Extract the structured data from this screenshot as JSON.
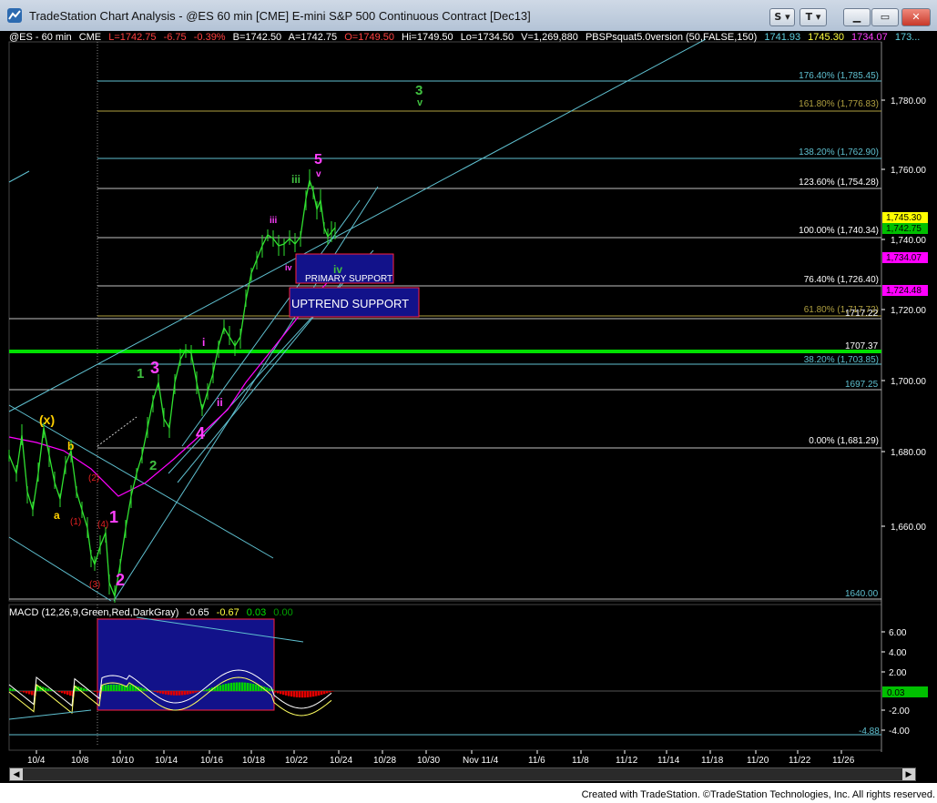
{
  "window": {
    "title": "TradeStation Chart Analysis - @ES 60 min [CME] E-mini S&P 500 Continuous Contract [Dec13]",
    "s_button": "S",
    "t_button": "T"
  },
  "header": {
    "symbol": "@ES - 60 min",
    "exchange": "CME",
    "last": "L=1742.75",
    "change": "-6.75",
    "pct_change": "-0.39%",
    "bid": "B=1742.50",
    "ask": "A=1742.75",
    "open": "O=1749.50",
    "high": "Hi=1749.50",
    "low": "Lo=1734.50",
    "volume": "V=1,269,880",
    "indicator": "PBSPsquat5.0version (50,FALSE,150)",
    "ind_v1": "1741.93",
    "ind_v2": "1745.30",
    "ind_v3": "1734.07",
    "ind_v4": "173..."
  },
  "price_axis": {
    "ticks": [
      "1,780.00",
      "1,760.00",
      "1,740.00",
      "1,720.00",
      "1,700.00",
      "1,680.00",
      "1,660.00"
    ],
    "tags": [
      {
        "text": "1,745.30",
        "bg": "#ffff00",
        "fg": "#000000"
      },
      {
        "text": "1,742.75",
        "bg": "#00c000",
        "fg": "#000000"
      },
      {
        "text": "1,734.07",
        "bg": "#ff00ff",
        "fg": "#000000"
      },
      {
        "text": "1,724.48",
        "bg": "#ff00ff",
        "fg": "#000000"
      }
    ]
  },
  "fib_labels": [
    {
      "text": "176.40% (1,785.45)",
      "color": "#5fc0d0"
    },
    {
      "text": "161.80% (1,776.83)",
      "color": "#b0a040"
    },
    {
      "text": "138.20% (1,762.90)",
      "color": "#5fc0d0"
    },
    {
      "text": "123.60% (1,754.28)",
      "color": "#ffffff"
    },
    {
      "text": "100.00% (1,740.34)",
      "color": "#ffffff"
    },
    {
      "text": "76.40% (1,726.40)",
      "color": "#ffffff"
    },
    {
      "text": "61.80% (1,717.72)",
      "color": "#b0a040"
    },
    {
      "text": "38.20% (1,703.85)",
      "color": "#5fc0d0"
    },
    {
      "text": "0.00% (1,681.29)",
      "color": "#ffffff"
    }
  ],
  "level_labels": {
    "l1717": "1717.22",
    "l1707": "1707.37",
    "l1697": "1697.25",
    "l1640": "1640.00"
  },
  "wave_labels": {
    "w3_big": "3",
    "v_big": "v",
    "w5": "5",
    "v_small": "v",
    "iii_green": "iii",
    "iii_pink": "iii",
    "iv_pink": "iv",
    "iv_green": "iv",
    "i_pink": "i",
    "ii_pink": "ii",
    "w1_green": "1",
    "w3_pink": "3",
    "w2_green": "2",
    "w4_pink": "4",
    "x": "(x)",
    "b": "b",
    "a": "a",
    "p2": "(2)",
    "p1": "(1)",
    "p4": "(4)",
    "p3": "(3)",
    "w1_pink": "1",
    "w2_pink": "2"
  },
  "boxes": {
    "primary": "PRIMARY SUPPORT",
    "uptrend": "UPTREND SUPPORT"
  },
  "macd": {
    "label": "MACD (12,26,9,Green,Red,DarkGray)",
    "v1": "-0.65",
    "v2": "-0.67",
    "v3": "0.03",
    "v4": "0.00",
    "ticks": [
      "6.00",
      "4.00",
      "2.00",
      "-2.00",
      "-4.00"
    ],
    "tag": "0.03",
    "low_label": "-4.88"
  },
  "time_axis": [
    "10/4",
    "10/8",
    "10/10",
    "10/14",
    "10/16",
    "10/18",
    "10/22",
    "10/24",
    "10/28",
    "10/30",
    "Nov 11/4",
    "11/6",
    "11/8",
    "11/12",
    "11/14",
    "11/18",
    "11/20",
    "11/22",
    "11/26"
  ],
  "status_bar": "Created with TradeStation. ©TradeStation Technologies, Inc. All rights reserved."
}
